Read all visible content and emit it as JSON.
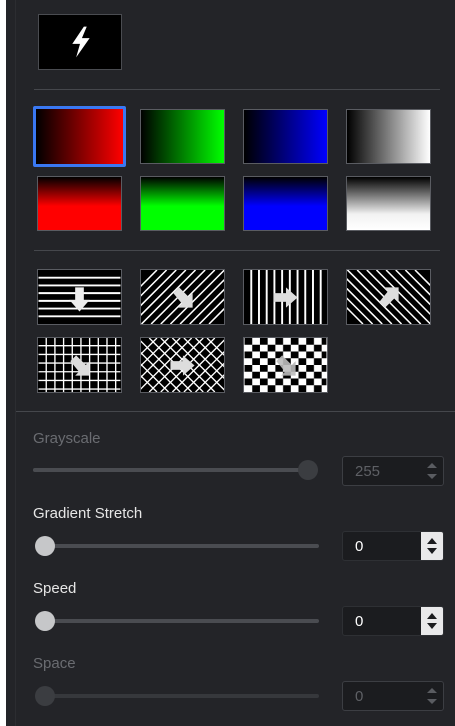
{
  "toolbar": {
    "flash_icon": "lightning-bolt-icon"
  },
  "colors": {
    "panel_bg": "#232428",
    "selection_accent": "#3a78f2",
    "red": "#ff0000",
    "green": "#00ff00",
    "blue": "#0000ff",
    "white": "#ffffff"
  },
  "gradient_presets": [
    {
      "name": "black-to-red",
      "selected": true
    },
    {
      "name": "black-to-green",
      "selected": false
    },
    {
      "name": "black-to-blue",
      "selected": false
    },
    {
      "name": "black-to-white",
      "selected": false
    },
    {
      "name": "red-to-black",
      "selected": false
    },
    {
      "name": "green-to-black",
      "selected": false
    },
    {
      "name": "blue-to-black",
      "selected": false
    },
    {
      "name": "white-to-black",
      "selected": false
    }
  ],
  "pattern_presets": [
    {
      "name": "horizontal-lines-moving-down",
      "icon": "arrow-down-icon"
    },
    {
      "name": "diagonal-lines-moving-down-right",
      "icon": "arrow-down-right-icon"
    },
    {
      "name": "vertical-lines-moving-right",
      "icon": "arrow-right-icon"
    },
    {
      "name": "diagonal-lines-moving-up-right",
      "icon": "arrow-up-right-icon"
    },
    {
      "name": "grid-moving-down-right",
      "icon": "arrow-down-right-icon"
    },
    {
      "name": "diagonal-grid-moving-right",
      "icon": "arrow-right-icon"
    },
    {
      "name": "checkerboard-moving-down-right",
      "icon": "arrow-down-right-icon"
    }
  ],
  "controls": {
    "grayscale": {
      "label": "Grayscale",
      "value": "255",
      "slider_fraction": 1.0,
      "enabled": false
    },
    "gradient_stretch": {
      "label": "Gradient Stretch",
      "value": "0",
      "slider_fraction": 0.0,
      "enabled": true
    },
    "speed": {
      "label": "Speed",
      "value": "0",
      "slider_fraction": 0.0,
      "enabled": true
    },
    "space": {
      "label": "Space",
      "value": "0",
      "slider_fraction": 0.0,
      "enabled": false
    }
  }
}
